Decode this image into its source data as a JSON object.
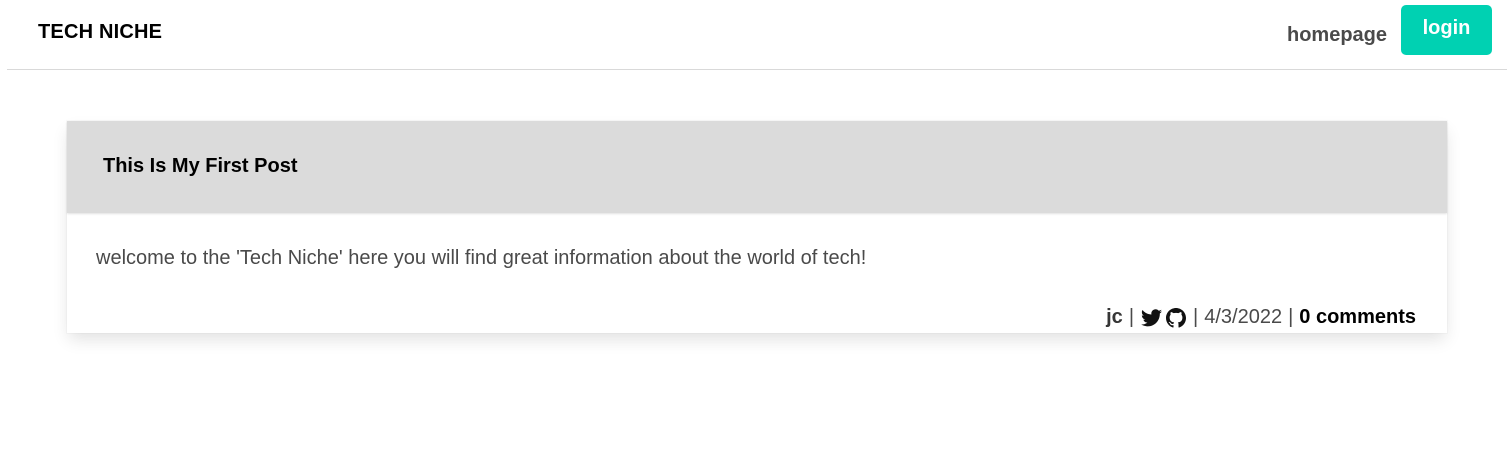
{
  "nav": {
    "brand": "TECH NICHE",
    "homepage_label": "homepage",
    "login_label": "login",
    "accent_color": "#00d1b2"
  },
  "post": {
    "title": "This Is My First Post",
    "body": "welcome to the 'Tech Niche' here you will find great information about the world of tech!",
    "author": "jc",
    "separator": "|",
    "icons": [
      "twitter-icon",
      "github-icon"
    ],
    "date": "4/3/2022",
    "comments_label": "0 comments"
  }
}
